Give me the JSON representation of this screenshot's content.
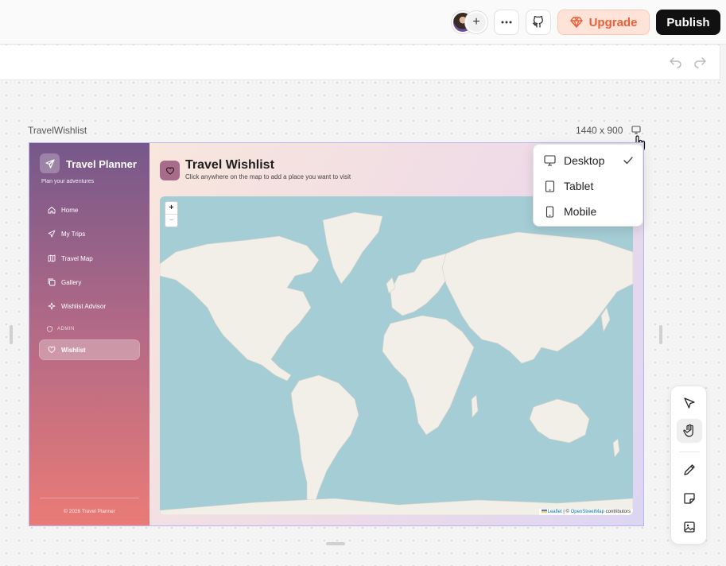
{
  "topbar": {
    "upgrade_label": "Upgrade",
    "publish_label": "Publish",
    "avatar_add": "+"
  },
  "canvas": {
    "frame_name": "TravelWishlist",
    "frame_size": "1440 x 900"
  },
  "device_menu": {
    "items": [
      {
        "label": "Desktop",
        "icon": "monitor-icon",
        "selected": true
      },
      {
        "label": "Tablet",
        "icon": "tablet-icon",
        "selected": false
      },
      {
        "label": "Mobile",
        "icon": "mobile-icon",
        "selected": false
      }
    ]
  },
  "app": {
    "brand_title": "Travel Planner",
    "brand_subtitle": "Plan your adventures",
    "nav": [
      {
        "label": "Home",
        "icon": "home-icon"
      },
      {
        "label": "My Trips",
        "icon": "plane-icon"
      },
      {
        "label": "Travel Map",
        "icon": "map-icon"
      },
      {
        "label": "Gallery",
        "icon": "gallery-icon"
      },
      {
        "label": "Wishlist Advisor",
        "icon": "sparkle-icon"
      }
    ],
    "section_label": "ADMIN",
    "active_item": {
      "label": "Wishlist",
      "icon": "heart-icon"
    },
    "footer": "© 2026 Travel Planner",
    "page_title": "Travel Wishlist",
    "page_subtitle": "Click anywhere on the map to add a place you want to visit",
    "map": {
      "zoom_in": "+",
      "zoom_out": "−",
      "attribution_leaflet": "Leaflet",
      "attribution_sep": " | © ",
      "attribution_osm": "OpenStreetMap",
      "attribution_tail": " contributors"
    }
  },
  "colors": {
    "accent_upgrade": "#e8603a",
    "publish_bg": "#111111",
    "frame_border": "#b9b3ef",
    "ocean": "#a5cdd6",
    "land": "#f2efe9"
  }
}
